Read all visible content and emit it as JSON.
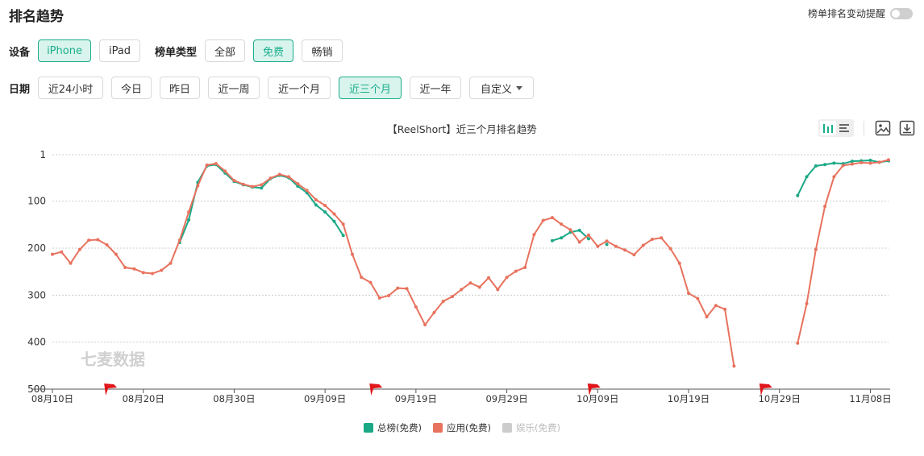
{
  "header": {
    "title": "排名趋势",
    "toggle_label": "榜单排名变动提醒"
  },
  "device": {
    "label": "设备",
    "options": [
      "iPhone",
      "iPad"
    ],
    "active": 0
  },
  "list_type": {
    "label": "榜单类型",
    "options": [
      "全部",
      "免费",
      "畅销"
    ],
    "active": 1
  },
  "date": {
    "label": "日期",
    "options": [
      "近24小时",
      "今日",
      "昨日",
      "近一周",
      "近一个月",
      "近三个月",
      "近一年"
    ],
    "active": 5,
    "custom_label": "自定义"
  },
  "colors": {
    "accent": "#1aad8d",
    "series_total": "#1aa886",
    "series_app": "#e8725e",
    "series_ent": "#cccccc",
    "flag": "#e0161b"
  },
  "watermark": "七麦数据",
  "chart_data": {
    "type": "line",
    "title": "【ReelShort】近三个月排名趋势",
    "y_inverted": true,
    "ylim": [
      1,
      500
    ],
    "y_ticks": [
      1,
      100,
      200,
      300,
      400,
      500
    ],
    "x_range": [
      0,
      92
    ],
    "x_ticks": [
      {
        "i": 0,
        "label": "08月10日"
      },
      {
        "i": 10,
        "label": "08月20日"
      },
      {
        "i": 20,
        "label": "08月30日"
      },
      {
        "i": 30,
        "label": "09月09日"
      },
      {
        "i": 40,
        "label": "09月19日"
      },
      {
        "i": 50,
        "label": "09月29日"
      },
      {
        "i": 60,
        "label": "10月09日"
      },
      {
        "i": 70,
        "label": "10月19日"
      },
      {
        "i": 80,
        "label": "10月29日"
      },
      {
        "i": 90,
        "label": "11月08日"
      }
    ],
    "flags_at_index": [
      6.4,
      35.6,
      59.6,
      78.5
    ],
    "grid": true,
    "legend_position": "bottom-center",
    "series": [
      {
        "name": "总榜(免费)",
        "color_key": "series_total",
        "points": [
          [
            14,
            188
          ],
          [
            15,
            140
          ],
          [
            16,
            60
          ],
          [
            17,
            25
          ],
          [
            18,
            22
          ],
          [
            19,
            40
          ],
          [
            20,
            58
          ],
          [
            21,
            65
          ],
          [
            22,
            70
          ],
          [
            23,
            72
          ],
          [
            24,
            52
          ],
          [
            25,
            45
          ],
          [
            26,
            50
          ],
          [
            27,
            68
          ],
          [
            28,
            82
          ],
          [
            29,
            108
          ],
          [
            30,
            123
          ],
          [
            31,
            143
          ],
          [
            32,
            173
          ],
          [
            55,
            184
          ],
          [
            56,
            178
          ],
          [
            57,
            166
          ],
          [
            58,
            162
          ],
          [
            59,
            180
          ],
          [
            61,
            192
          ],
          [
            82,
            88
          ],
          [
            83,
            48
          ],
          [
            84,
            25
          ],
          [
            85,
            22
          ],
          [
            86,
            19
          ],
          [
            87,
            20
          ],
          [
            88,
            15
          ],
          [
            89,
            14
          ],
          [
            90,
            13
          ],
          [
            91,
            17
          ],
          [
            92,
            14
          ]
        ]
      },
      {
        "name": "应用(免费)",
        "color_key": "series_app",
        "points": [
          [
            0,
            213
          ],
          [
            1,
            208
          ],
          [
            2,
            232
          ],
          [
            3,
            203
          ],
          [
            4,
            183
          ],
          [
            5,
            182
          ],
          [
            6,
            193
          ],
          [
            7,
            213
          ],
          [
            8,
            241
          ],
          [
            9,
            244
          ],
          [
            10,
            252
          ],
          [
            11,
            254
          ],
          [
            12,
            247
          ],
          [
            13,
            232
          ],
          [
            14,
            183
          ],
          [
            15,
            123
          ],
          [
            16,
            67
          ],
          [
            17,
            23
          ],
          [
            18,
            20
          ],
          [
            19,
            36
          ],
          [
            20,
            56
          ],
          [
            21,
            64
          ],
          [
            22,
            69
          ],
          [
            23,
            65
          ],
          [
            24,
            51
          ],
          [
            25,
            43
          ],
          [
            26,
            48
          ],
          [
            27,
            63
          ],
          [
            28,
            77
          ],
          [
            29,
            97
          ],
          [
            30,
            109
          ],
          [
            31,
            127
          ],
          [
            32,
            149
          ],
          [
            33,
            213
          ],
          [
            34,
            262
          ],
          [
            35,
            273
          ],
          [
            36,
            306
          ],
          [
            37,
            301
          ],
          [
            38,
            285
          ],
          [
            39,
            286
          ],
          [
            40,
            325
          ],
          [
            41,
            363
          ],
          [
            42,
            337
          ],
          [
            43,
            313
          ],
          [
            44,
            303
          ],
          [
            45,
            288
          ],
          [
            46,
            274
          ],
          [
            47,
            283
          ],
          [
            48,
            263
          ],
          [
            49,
            288
          ],
          [
            50,
            262
          ],
          [
            51,
            249
          ],
          [
            52,
            241
          ],
          [
            53,
            171
          ],
          [
            54,
            141
          ],
          [
            55,
            135
          ],
          [
            56,
            149
          ],
          [
            57,
            161
          ],
          [
            58,
            187
          ],
          [
            59,
            172
          ],
          [
            60,
            196
          ],
          [
            61,
            185
          ],
          [
            62,
            196
          ],
          [
            63,
            204
          ],
          [
            64,
            214
          ],
          [
            65,
            194
          ],
          [
            66,
            181
          ],
          [
            67,
            178
          ],
          [
            68,
            201
          ],
          [
            69,
            232
          ],
          [
            70,
            296
          ],
          [
            71,
            307
          ],
          [
            72,
            346
          ],
          [
            73,
            322
          ],
          [
            74,
            330
          ],
          [
            75,
            451
          ],
          [
            82,
            402
          ],
          [
            83,
            318
          ],
          [
            84,
            203
          ],
          [
            85,
            111
          ],
          [
            86,
            48
          ],
          [
            87,
            24
          ],
          [
            88,
            21
          ],
          [
            89,
            18
          ],
          [
            90,
            19
          ],
          [
            91,
            17
          ],
          [
            92,
            12
          ]
        ]
      },
      {
        "name": "娱乐(免费)",
        "color_key": "series_ent",
        "points": []
      }
    ]
  }
}
